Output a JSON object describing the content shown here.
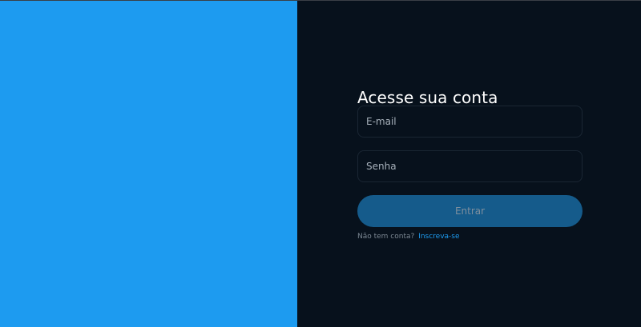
{
  "colors": {
    "left_panel": "#1d9bf0",
    "right_panel": "#07111c",
    "button": "#155b8b",
    "link": "#1d9bf0"
  },
  "login": {
    "title": "Acesse sua conta",
    "email_placeholder": "E-mail",
    "password_placeholder": "Senha",
    "submit_label": "Entrar",
    "signup_prompt": "Não tem conta?",
    "signup_link": "Inscreva-se"
  }
}
